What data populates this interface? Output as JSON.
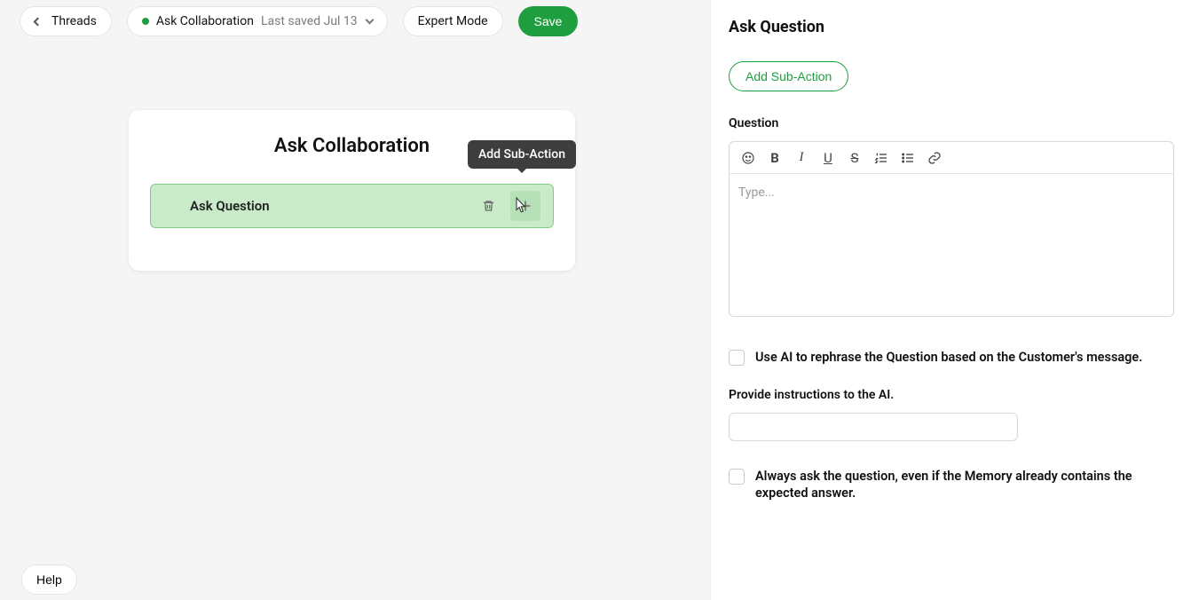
{
  "top": {
    "back_label": "Threads",
    "flow_name": "Ask Collaboration",
    "saved_label": "Last saved Jul 13",
    "expert_label": "Expert Mode",
    "save_label": "Save"
  },
  "card": {
    "title": "Ask Collaboration",
    "action_label": "Ask Question"
  },
  "tooltip_text": "Add Sub-Action",
  "help_label": "Help",
  "panel": {
    "title": "Ask Question",
    "add_sub_label": "Add Sub-Action",
    "question_label": "Question",
    "editor_placeholder": "Type...",
    "ai_rephrase_label": "Use AI to rephrase the Question based on the Customer's message.",
    "ai_instructions_label": "Provide instructions to the AI.",
    "always_ask_label": "Always ask the question, even if the Memory already contains the expected answer."
  }
}
